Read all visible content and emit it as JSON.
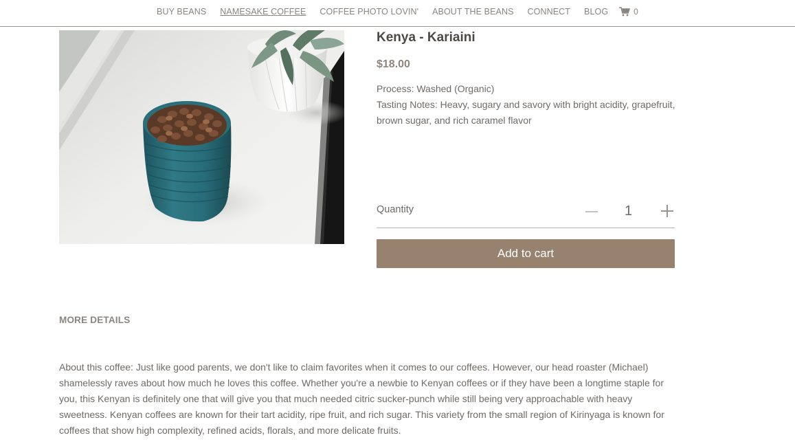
{
  "nav": {
    "items": [
      {
        "label": "BUY BEANS"
      },
      {
        "label": "NAMESAKE COFFEE"
      },
      {
        "label": "COFFEE PHOTO LOVIN'"
      },
      {
        "label": "ABOUT THE BEANS"
      },
      {
        "label": "CONNECT"
      },
      {
        "label": "BLOG"
      }
    ],
    "active_item": "NAMESAKE COFFEE",
    "cart_icon": "shopping-cart-icon",
    "cart_count": "0"
  },
  "product": {
    "image_alt": "Blue ceramic cup filled with coffee beans next to a succulent on a windowsill",
    "title": "Kenya - Kariaini",
    "price": "$18.00",
    "process": "Process: Washed (Organic)",
    "tasting_notes": "Tasting Notes: Heavy, sugary and savory with bright acidity, grapefruit, brown sugar, and rich caramel flavor",
    "quantity_label": "Quantity",
    "quantity_value": "1",
    "add_to_cart_label": "Add to cart"
  },
  "details": {
    "heading": "MORE DETAILS",
    "about": "About this coffee: Just like good parents, we don't like to claim favorites when it comes to our coffees. However, our head roaster (Michael) shamelessly raves about how much he loves this coffee. Whether you're a newbie to Kenyan coffees or if they have been a longtime staple for you, this Kenyan is definitely one that will give you that much needed citric sucker-punch while still being very approachable with heavy sweetness. Kenyan coffees are known for their tart acidity, ripe fruit, and rich sugar. This variety from the small region of Kirinyaga is known for coffees that show high complexity, refined acids, florals, and more delicate fruits."
  },
  "colors": {
    "button_bg": "#978270",
    "title_text": "#4d4945",
    "price_text": "#8e857d",
    "body_text": "#6f6a66",
    "nav_border": "#9c948c"
  }
}
